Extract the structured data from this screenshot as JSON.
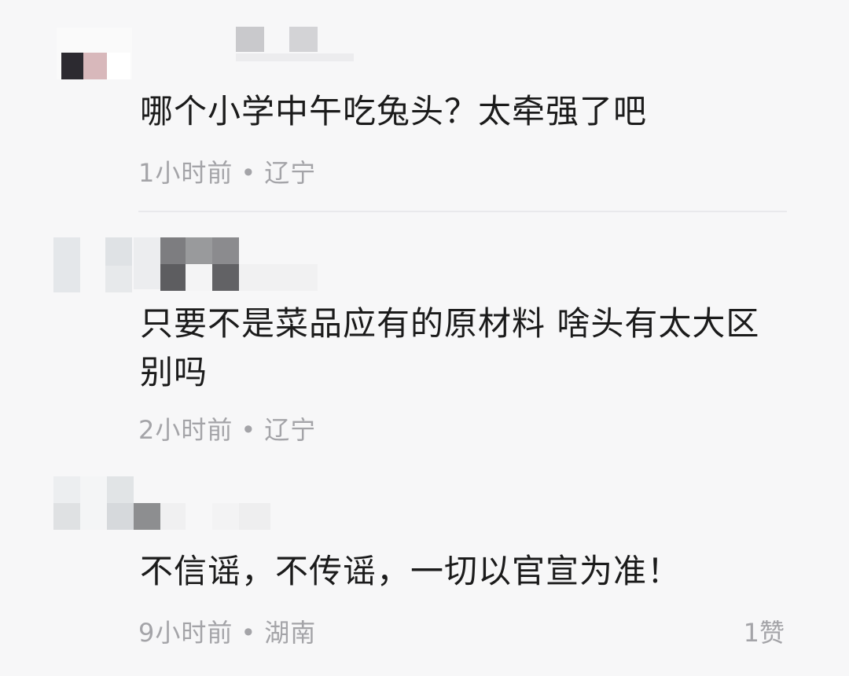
{
  "comments": [
    {
      "text": "哪个小学中午吃兔头？太牵强了吧",
      "time": "1小时前",
      "separator": "•",
      "location": "辽宁",
      "likes": ""
    },
    {
      "text": "只要不是菜品应有的原材料 啥头有太大区别吗",
      "time": "2小时前",
      "separator": "•",
      "location": "辽宁",
      "likes": ""
    },
    {
      "text": "不信谣，不传谣，一切以官宣为准！",
      "time": "9小时前",
      "separator": "•",
      "location": "湖南",
      "likes": "1赞"
    }
  ],
  "colors": {
    "background": "#f7f7f8",
    "text": "#1b1b1b",
    "meta": "#a4a4a8",
    "divider": "#e9e9ec"
  }
}
